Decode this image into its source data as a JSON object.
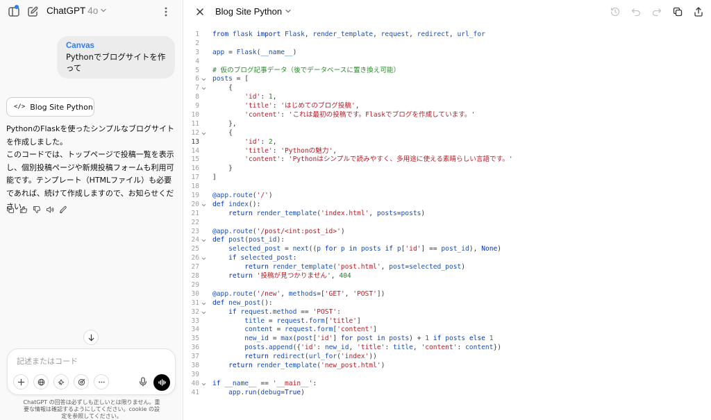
{
  "header": {
    "model_name": "ChatGPT",
    "model_version": "4o",
    "icons": [
      "sidebar-icon",
      "new-chat-icon",
      "more-vertical-icon"
    ]
  },
  "chat": {
    "user_message": {
      "tag": "Canvas",
      "text": "Pythonでブログサイトを作って"
    },
    "canvas_chip_label": "Blog Site Python",
    "reply_lines": [
      "PythonのFlaskを使ったシンプルなブログサイトを作成しました。",
      "このコードでは、トップページで投稿一覧を表示し、個別投稿ページや新規投稿フォームも利用可能です。テンプレート（HTMLファイル）も必要であれば、続けて作成しますので、お知らせください。"
    ],
    "action_icons": [
      "copy-icon",
      "thumbs-up-icon",
      "thumbs-down-icon",
      "read-aloud-icon",
      "edit-icon"
    ]
  },
  "composer": {
    "placeholder": "記述またはコード",
    "buttons": [
      "plus-icon",
      "globe-icon",
      "sparkle-icon",
      "paint-icon",
      "more-horizontal-icon"
    ],
    "mic_icon": "mic-icon",
    "voice_icon": "voice-mode-icon"
  },
  "disclaimer": "ChatGPT の回答は必ずしも正しいとは限りません。重要な情報は確認するようにしてください。cookie の設定を参照してください。",
  "canvas": {
    "title": "Blog Site Python",
    "toolbar_icons": [
      "history-icon",
      "undo-icon",
      "redo-icon",
      "copy-icon",
      "share-icon"
    ],
    "active_line": 13,
    "folded_lines": [
      6,
      7,
      12,
      20,
      24,
      26,
      31,
      32,
      40
    ],
    "code_lines": [
      "from flask import Flask, render_template, request, redirect, url_for",
      "",
      "app = Flask(__name__)",
      "",
      "# 仮のブログ記事データ（後でデータベースに置き換え可能）",
      "posts = [",
      "    {",
      "        'id': 1,",
      "        'title': 'はじめてのブログ投稿',",
      "        'content': 'これは最初の投稿です。Flaskでブログを作成しています。'",
      "    },",
      "    {",
      "        'id': 2,",
      "        'title': 'Pythonの魅力',",
      "        'content': 'Pythonはシンプルで読みやすく、多用途に使える素晴らしい言語です。'",
      "    }",
      "]",
      "",
      "@app.route('/')",
      "def index():",
      "    return render_template('index.html', posts=posts)",
      "",
      "@app.route('/post/<int:post_id>')",
      "def post(post_id):",
      "    selected_post = next((p for p in posts if p['id'] == post_id), None)",
      "    if selected_post:",
      "        return render_template('post.html', post=selected_post)",
      "    return '投稿が見つかりません', 404",
      "",
      "@app.route('/new', methods=['GET', 'POST'])",
      "def new_post():",
      "    if request.method == 'POST':",
      "        title = request.form['title']",
      "        content = request.form['content']",
      "        new_id = max(post['id'] for post in posts) + 1 if posts else 1",
      "        posts.append({'id': new_id, 'title': title, 'content': content})",
      "        return redirect(url_for('index'))",
      "    return render_template('new_post.html')",
      "",
      "if __name__ == '__main__':",
      "    app.run(debug=True)"
    ]
  }
}
